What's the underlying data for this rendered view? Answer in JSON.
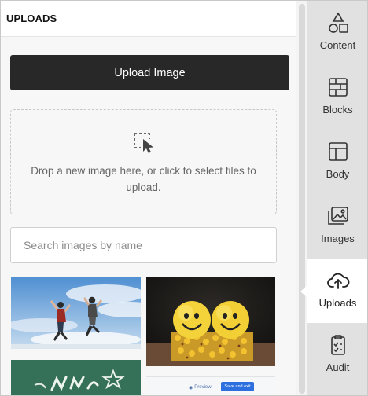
{
  "panel": {
    "title": "UPLOADS",
    "upload_button_label": "Upload Image",
    "dropzone_text": "Drop a new image here, or click to select files to upload.",
    "search_placeholder": "Search images by name",
    "thumbnail_overlay": {
      "preview_label": "Preview",
      "save_label": "Save and exit"
    }
  },
  "nav": {
    "items": [
      {
        "label": "Content",
        "icon": "shapes-icon",
        "active": false
      },
      {
        "label": "Blocks",
        "icon": "blocks-icon",
        "active": false
      },
      {
        "label": "Body",
        "icon": "layout-icon",
        "active": false
      },
      {
        "label": "Images",
        "icon": "images-icon",
        "active": false
      },
      {
        "label": "Uploads",
        "icon": "cloud-upload-icon",
        "active": true
      },
      {
        "label": "Audit",
        "icon": "clipboard-check-icon",
        "active": false
      }
    ]
  },
  "colors": {
    "button_dark": "#282828",
    "rail_bg": "#e1e1e1",
    "active_bg": "#ffffff",
    "accent_blue": "#2e6fe0"
  }
}
